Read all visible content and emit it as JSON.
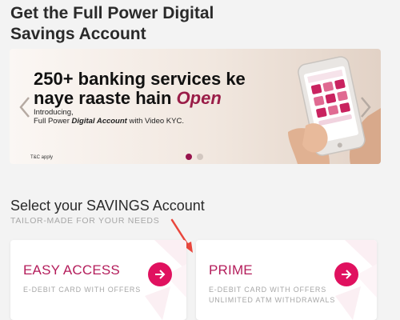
{
  "page": {
    "title_line1": "Get the Full Power Digital",
    "title_line2": "Savings Account"
  },
  "banner": {
    "headline_line1": "250+ banking services ke",
    "headline_line2_prefix": "naye raaste hain ",
    "headline_accent": "Open",
    "sub_line1": "Introducing,",
    "sub_line2_prefix": "Full Power ",
    "sub_line2_emphasis": "Digital Account",
    "sub_line2_suffix": " with Video KYC.",
    "tc": "T&C apply",
    "prev_icon": "chevron-left-icon",
    "next_icon": "chevron-right-icon",
    "dots_total": 2,
    "active_dot": 1
  },
  "savings": {
    "heading": "Select your SAVINGS Account",
    "subheading": "TAILOR-MADE FOR YOUR NEEDS"
  },
  "cards": [
    {
      "title": "EASY ACCESS",
      "features": [
        "E-DEBIT CARD WITH OFFERS"
      ],
      "icon": "arrow-right-icon"
    },
    {
      "title": "PRIME",
      "features": [
        "E-DEBIT CARD WITH OFFERS",
        "UNLIMITED ATM WITHDRAWALS"
      ],
      "icon": "arrow-right-icon"
    }
  ],
  "colors": {
    "brand": "#97144d",
    "accent": "#e0115f",
    "annotation": "#e9463c"
  }
}
